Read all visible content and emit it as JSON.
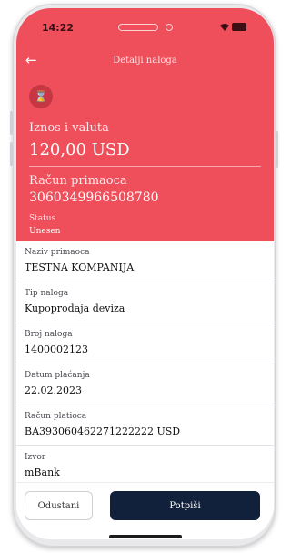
{
  "status_bar": {
    "time": "14:22",
    "wifi_icon": "wifi-icon",
    "battery_icon": "battery-icon"
  },
  "header": {
    "back_icon": "back-arrow-icon",
    "title": "Detalji naloga"
  },
  "summary": {
    "status_icon": "hourglass-icon",
    "amount_label": "Iznos i valuta",
    "amount_value": "120,00 USD",
    "account_label": "Račun primaoca",
    "account_value": "3060349966508780",
    "status_label": "Status",
    "status_value": "Unesen"
  },
  "details": [
    {
      "label": "Naziv primaoca",
      "value": "TESTNA KOMPANIJA"
    },
    {
      "label": "Tip naloga",
      "value": "Kupoprodaja deviza"
    },
    {
      "label": "Broj naloga",
      "value": "1400002123"
    },
    {
      "label": "Datum plaćanja",
      "value": "22.02.2023"
    },
    {
      "label": "Račun platioca",
      "value": "BA393060462271222222 USD"
    },
    {
      "label": "Izvor",
      "value": "mBank"
    }
  ],
  "footer": {
    "cancel_label": "Odustani",
    "sign_label": "Potpiši"
  },
  "colors": {
    "accent_red": "#ef4f5a",
    "primary_button": "#12213b"
  }
}
